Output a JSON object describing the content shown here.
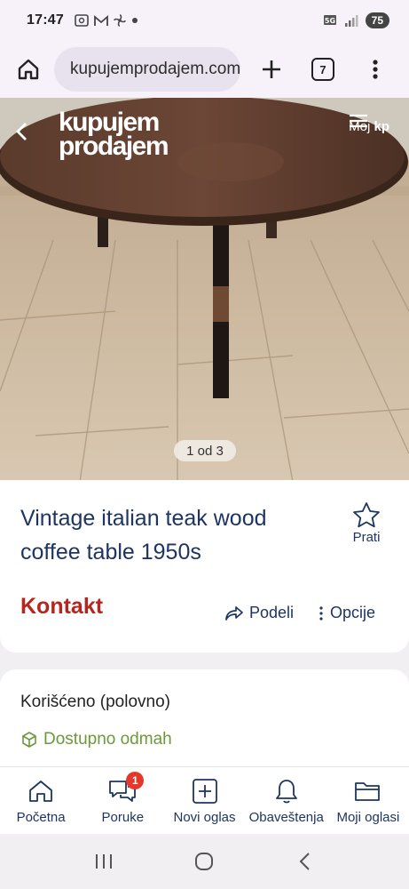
{
  "status_bar": {
    "time": "17:47",
    "network": "5G",
    "battery": "75"
  },
  "browser": {
    "url": "kupujemprodajem.com",
    "tab_count": "7"
  },
  "header": {
    "logo_line1": "kupujem",
    "logo_line2": "prodajem",
    "logo_reg": "®",
    "account_label_prefix": "Moj",
    "account_label_suffix": "kp"
  },
  "gallery": {
    "counter": "1 od 3"
  },
  "listing": {
    "title": "Vintage italian teak wood coffee table 1950s",
    "follow_label": "Prati",
    "contact_label": "Kontakt",
    "share_label": "Podeli",
    "options_label": "Opcije",
    "condition": "Korišćeno (polovno)",
    "availability": "Dostupno odmah"
  },
  "bottom_nav": {
    "items": [
      {
        "label": "Početna",
        "icon": "home-icon"
      },
      {
        "label": "Poruke",
        "icon": "chat-icon",
        "badge": "1"
      },
      {
        "label": "Novi oglas",
        "icon": "plus-square-icon"
      },
      {
        "label": "Obaveštenja",
        "icon": "bell-icon"
      },
      {
        "label": "Moji oglasi",
        "icon": "folder-icon"
      }
    ]
  },
  "colors": {
    "brand_navy": "#1d3563",
    "contact_red": "#b5261e",
    "available_green": "#6a9a3a",
    "badge_red": "#e5382c"
  }
}
